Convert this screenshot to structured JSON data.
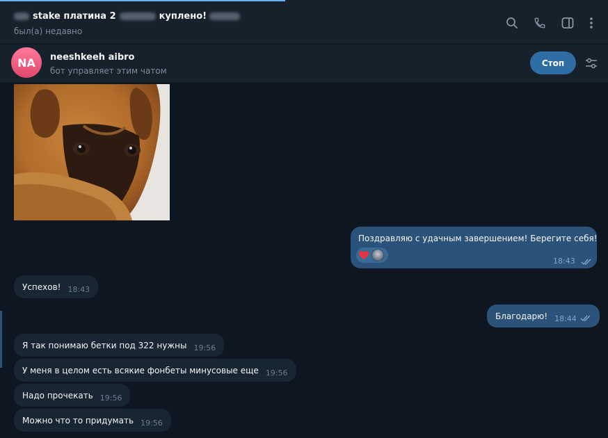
{
  "header": {
    "title_prefix_blurred": "blurred",
    "title_part1": "stake платина 2",
    "title_part2": "куплено!",
    "status": "был(а) недавно"
  },
  "header_icons": [
    "search-icon",
    "phone-icon",
    "sidebar-toggle-icon",
    "more-vertical-icon"
  ],
  "bot": {
    "avatar_initials": "NA",
    "name": "neeshkeeh aibro",
    "subtitle": "бот управляет этим чатом",
    "stop_label": "Стоп"
  },
  "messages": [
    {
      "direction": "in",
      "type": "image",
      "description_icon": "dog-photo"
    },
    {
      "direction": "out",
      "text": "Поздравляю с удачным завершением! Берегите себя!",
      "time": "18:43",
      "read": true,
      "reactions": [
        "heart",
        "avatar"
      ]
    },
    {
      "direction": "in",
      "text": "Успехов!",
      "time": "18:43"
    },
    {
      "direction": "out",
      "text": "Благодарю!",
      "time": "18:44",
      "read": true
    },
    {
      "direction": "in",
      "text": "Я так понимаю бетки под 322 нужны",
      "time": "19:56"
    },
    {
      "direction": "in",
      "text": "У меня в целом есть всякие фонбеты минусовые еще",
      "time": "19:56"
    },
    {
      "direction": "in",
      "text": "Надо прочекать",
      "time": "19:56"
    },
    {
      "direction": "in",
      "text": "Можно что то придумать",
      "time": "19:56"
    }
  ],
  "colors": {
    "background": "#0e1621",
    "header": "#17212b",
    "incoming_bubble": "#182533",
    "outgoing_bubble": "#2b5278",
    "accent": "#6ab3f3",
    "stop_button": "#2f6ea5",
    "avatar": "#e0466a"
  }
}
